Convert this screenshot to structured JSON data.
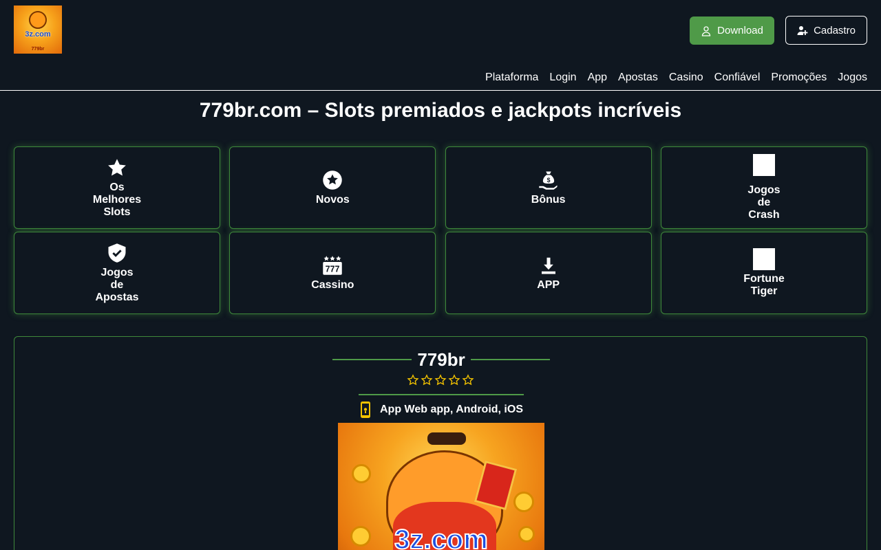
{
  "header": {
    "logo": {
      "brand_text": "3z.com",
      "small_text": "779br"
    },
    "download_label": "Download",
    "cadastro_label": "Cadastro"
  },
  "nav": [
    "Plataforma",
    "Login",
    "App",
    "Apostas",
    "Casino",
    "Confiável",
    "Promoções",
    "Jogos"
  ],
  "page_title": "779br.com – Slots premiados e jackpots incríveis",
  "categories": [
    {
      "label": "Os\nMelhores\nSlots",
      "icon": "star-icon"
    },
    {
      "label": "Novos",
      "icon": "circle-star-icon"
    },
    {
      "label": "Bônus",
      "icon": "money-bag-hand-icon"
    },
    {
      "label": "Jogos\nde\nCrash",
      "icon": "image-placeholder"
    },
    {
      "label": "Jogos\nde\nApostas",
      "icon": "shield-check-icon"
    },
    {
      "label": "Cassino",
      "icon": "slot-777-icon"
    },
    {
      "label": "APP",
      "icon": "download-icon"
    },
    {
      "label": "Fortune\nTiger",
      "icon": "image-placeholder"
    }
  ],
  "panel": {
    "title": "779br",
    "rating": 5,
    "app_label": "App Web app, Android, iOS",
    "hero_text": "3z.com"
  },
  "colors": {
    "background": "#0f1720",
    "accent_green": "#4f9a48",
    "star_yellow": "#f2c200"
  }
}
